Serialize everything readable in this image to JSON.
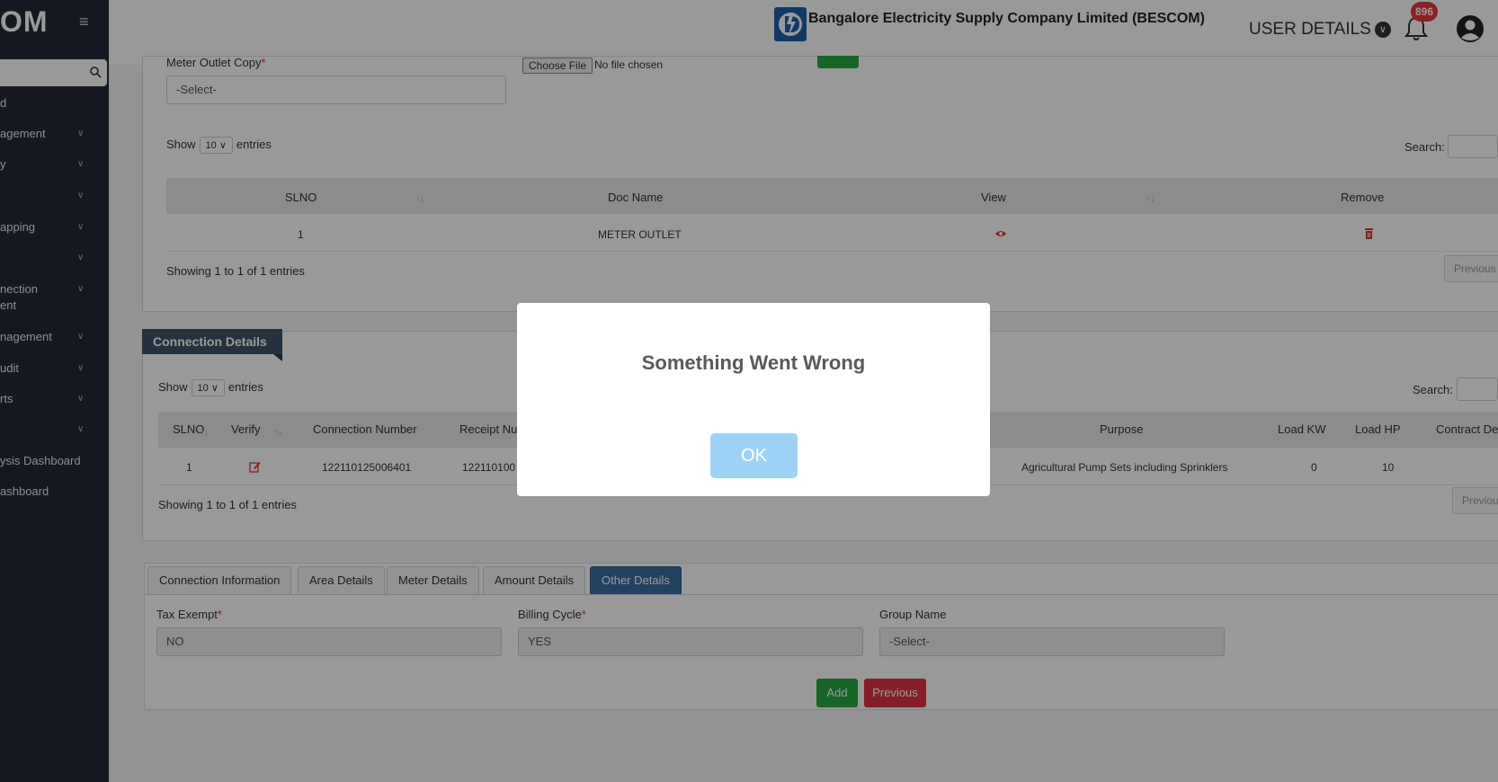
{
  "sidebar": {
    "logo_text": "OM",
    "items": [
      {
        "label": "d",
        "chevron": false
      },
      {
        "label": "agement",
        "chevron": true
      },
      {
        "label": "y",
        "chevron": true
      },
      {
        "label": "",
        "chevron": true
      },
      {
        "label": "apping",
        "chevron": true
      },
      {
        "label": "",
        "chevron": true
      },
      {
        "label": "nection",
        "label2": "ent",
        "chevron": true
      },
      {
        "label": "nagement",
        "chevron": true
      },
      {
        "label": "udit",
        "chevron": true
      },
      {
        "label": "rts",
        "chevron": true
      },
      {
        "label": "",
        "chevron": true
      },
      {
        "label": "ysis Dashboard",
        "chevron": false
      },
      {
        "label": "ashboard",
        "chevron": false
      }
    ]
  },
  "header": {
    "title": "Bangalore Electricity Supply Company Limited (BESCOM)",
    "user_menu": "USER DETAILS",
    "notification_count": "896"
  },
  "docs": {
    "meter_outlet_label": "Meter Outlet Copy",
    "meter_outlet_required": "*",
    "meter_outlet_select": "-Select-",
    "choose_file": "Choose File",
    "no_file": "No file chosen",
    "show": "Show",
    "entries_value": "10",
    "entries": "entries",
    "search_label": "Search:",
    "columns": [
      "SLNO",
      "Doc Name",
      "View",
      "Remove"
    ],
    "rows": [
      {
        "slno": "1",
        "doc_name": "METER OUTLET"
      }
    ],
    "info": "Showing 1 to 1 of 1 entries",
    "previous": "Previous"
  },
  "connection": {
    "section_title": "Connection Details",
    "show": "Show",
    "entries_value": "10",
    "entries": "entries",
    "search_label": "Search:",
    "columns": [
      "SLNO",
      "Verify",
      "Connection Number",
      "Receipt Nu",
      "Purpose",
      "Load KW",
      "Load HP",
      "Contract De"
    ],
    "rows": [
      {
        "slno": "1",
        "connection_number": "122110125006401",
        "receipt": "122110100",
        "purpose": "Agricultural Pump Sets including Sprinklers",
        "load_kw": "0",
        "load_hp": "10"
      }
    ],
    "info": "Showing 1 to 1 of 1 entries",
    "previous": "Previou"
  },
  "tabs": [
    {
      "label": "Connection Information",
      "active": false
    },
    {
      "label": "Area Details",
      "active": false
    },
    {
      "label": "Meter Details",
      "active": false
    },
    {
      "label": "Amount Details",
      "active": false
    },
    {
      "label": "Other Details",
      "active": true
    }
  ],
  "other_details": {
    "tax_exempt_label": "Tax Exempt",
    "tax_exempt_value": "NO",
    "billing_cycle_label": "Billing Cycle",
    "billing_cycle_value": "YES",
    "group_name_label": "Group Name",
    "group_name_value": "-Select-",
    "required_mark": "*",
    "add_button": "Add",
    "previous_button": "Previous"
  },
  "modal": {
    "title": "Something Went Wrong",
    "ok": "OK"
  },
  "colors": {
    "sidebar_bg": "#222b36",
    "section_tag": "#3f5468",
    "active_tab": "#3b6fa3",
    "add_button": "#28a745",
    "previous_button": "#dc3545",
    "ok_button": "#9fd3f5",
    "notification_badge": "#e03b3b"
  }
}
